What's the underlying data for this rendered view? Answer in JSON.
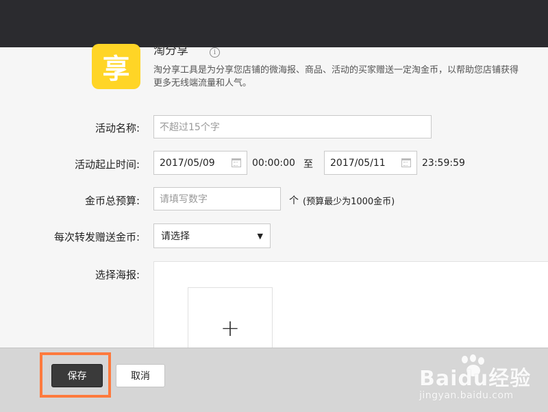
{
  "app": {
    "icon_char": "享",
    "title": "淘分享",
    "info_glyph": "i",
    "description": "淘分享工具是为分享您店铺的微海报、商品、活动的买家赠送一定淘金币，以帮助您店铺获得更多无线端流量和人气。"
  },
  "form": {
    "name": {
      "label": "活动名称:",
      "placeholder": "不超过15个字"
    },
    "period": {
      "label": "活动起止时间:",
      "start_date": "2017/05/09",
      "start_time": "00:00:00",
      "separator": "至",
      "end_date": "2017/05/11",
      "end_time": "23:59:59"
    },
    "budget": {
      "label": "金币总预算:",
      "placeholder": "请填写数字",
      "unit": "个",
      "hint": "(预算最少为1000金币)"
    },
    "per_share": {
      "label": "每次转发赠送金币:",
      "selected": "请选择"
    },
    "poster": {
      "label": "选择海报:",
      "add_glyph": "+"
    }
  },
  "footer": {
    "save_label": "保存",
    "cancel_label": "取消"
  },
  "watermark": {
    "brand": "Baidu经验",
    "url": "jingyan.baidu.com"
  },
  "colors": {
    "topbar": "#2b2b2f",
    "app_icon": "#ffd526",
    "highlight": "#ff7a3d",
    "save_button": "#3a3a3a"
  }
}
